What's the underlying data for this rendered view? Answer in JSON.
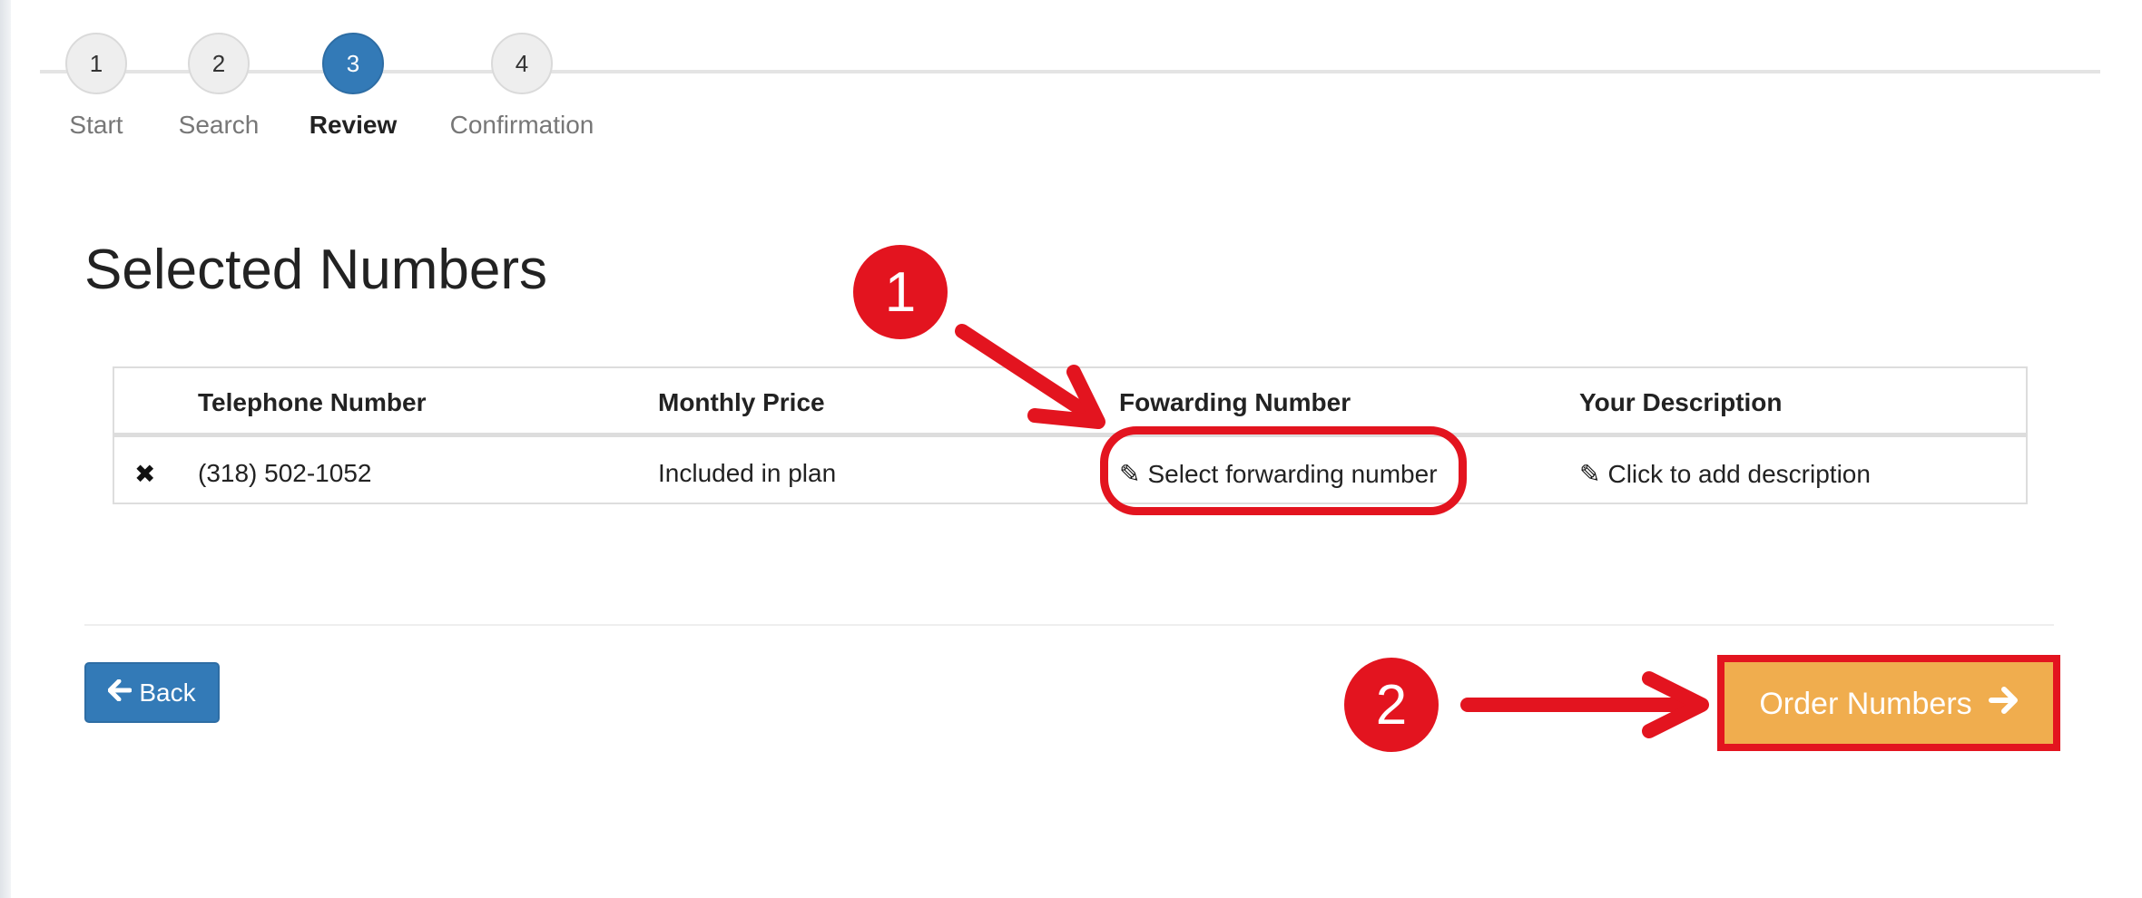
{
  "stepper": {
    "steps": [
      {
        "number": "1",
        "label": "Start"
      },
      {
        "number": "2",
        "label": "Search"
      },
      {
        "number": "3",
        "label": "Review"
      },
      {
        "number": "4",
        "label": "Confirmation"
      }
    ],
    "active_step": 3
  },
  "page_title": "Selected Numbers",
  "table": {
    "columns": [
      "Telephone Number",
      "Monthly Price",
      "Fowarding Number",
      "Your Description"
    ],
    "rows": [
      {
        "telephone_number": "(318) 502-1052",
        "monthly_price": "Included in plan",
        "forwarding_number": "Select forwarding number",
        "description": "Click to add description"
      }
    ]
  },
  "buttons": {
    "back_label": "Back",
    "order_label": "Order Numbers"
  },
  "annotations": {
    "marker_1": "1",
    "marker_2": "2"
  },
  "colors": {
    "primary": "#337ab7",
    "warning": "#f0ad4e",
    "annotation_red": "#e3141f"
  }
}
